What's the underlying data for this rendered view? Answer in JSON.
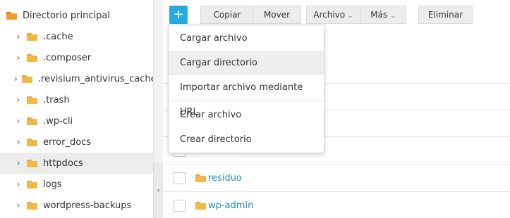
{
  "sidebar": {
    "root_label": "Directorio principal",
    "items": [
      {
        "label": ".cache"
      },
      {
        "label": ".composer"
      },
      {
        "label": ".revisium_antivirus_cache"
      },
      {
        "label": ".trash"
      },
      {
        "label": ".wp-cli"
      },
      {
        "label": "error_docs"
      },
      {
        "label": "httpdocs"
      },
      {
        "label": "logs"
      },
      {
        "label": "wordpress-backups"
      }
    ],
    "selected": "httpdocs",
    "collapse_glyph": "‹"
  },
  "toolbar": {
    "add_glyph": "+",
    "copy_label": "Copiar",
    "move_label": "Mover",
    "file_label": "Archivo",
    "more_label": "Más",
    "delete_label": "Eliminar",
    "caret": "⌄"
  },
  "menu": {
    "items": [
      {
        "label": "Cargar archivo"
      },
      {
        "label": "Cargar directorio"
      },
      {
        "label": "Importar archivo mediante URL"
      },
      {
        "label": "Crear archivo"
      },
      {
        "label": "Crear directorio"
      }
    ],
    "highlighted": "Cargar directorio"
  },
  "files": [
    {
      "name": "residuo"
    },
    {
      "name": "wp-admin"
    }
  ],
  "colors": {
    "accent": "#28a9e0",
    "link": "#1f8dc4",
    "folder": "#f0b846",
    "root_folder": "#f29a2e"
  }
}
